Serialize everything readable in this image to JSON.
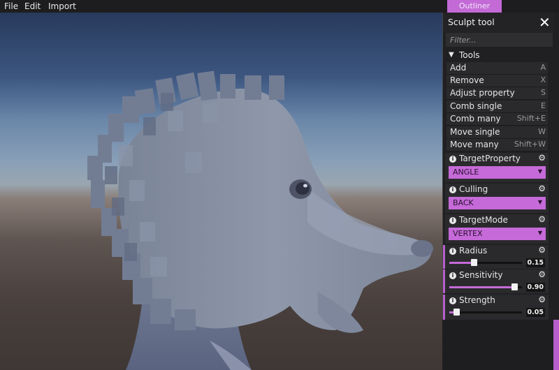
{
  "menu": [
    "File",
    "Edit",
    "Import"
  ],
  "outliner_tab": "Outliner",
  "panel": {
    "title": "Sculpt tool",
    "filter_placeholder": "Filter...",
    "tools_header": "Tools",
    "tools": [
      {
        "name": "Add",
        "shortcut": "A"
      },
      {
        "name": "Remove",
        "shortcut": "X"
      },
      {
        "name": "Adjust property",
        "shortcut": "S"
      },
      {
        "name": "Comb single",
        "shortcut": "E"
      },
      {
        "name": "Comb many",
        "shortcut": "Shift+E"
      },
      {
        "name": "Move single",
        "shortcut": "W"
      },
      {
        "name": "Move many",
        "shortcut": "Shift+W"
      }
    ],
    "properties": {
      "target_property": {
        "label": "TargetProperty",
        "value": "ANGLE"
      },
      "culling": {
        "label": "Culling",
        "value": "BACK"
      },
      "target_mode": {
        "label": "TargetMode",
        "value": "VERTEX"
      },
      "radius": {
        "label": "Radius",
        "value": "0.15",
        "fraction": 0.34
      },
      "sensitivity": {
        "label": "Sensitivity",
        "value": "0.90",
        "fraction": 0.89
      },
      "strength": {
        "label": "Strength",
        "value": "0.05",
        "fraction": 0.1
      }
    }
  },
  "colors": {
    "accent": "#c56ad8",
    "panel_bg": "#202022",
    "row_bg": "#2a2a2d"
  },
  "icons": {
    "close": "close-icon",
    "info": "info-icon",
    "settings": "gear-icon",
    "chevron": "chevron-down-icon",
    "dropdown": "caret-down-icon"
  }
}
